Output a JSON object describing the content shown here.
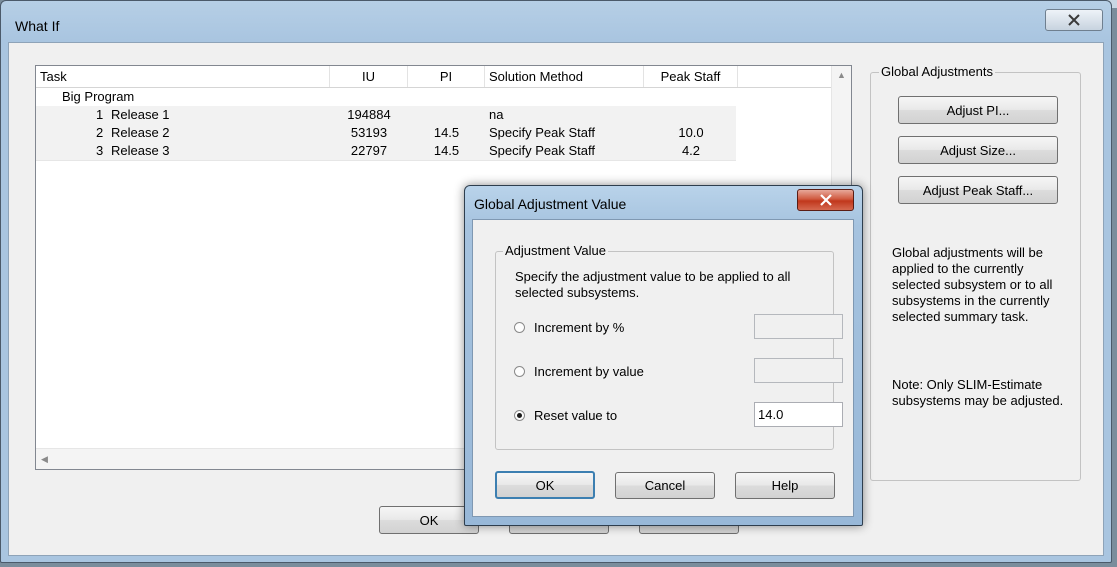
{
  "window": {
    "title": "What If"
  },
  "grid": {
    "headers": {
      "task": "Task",
      "iu": "IU",
      "pi": "PI",
      "method": "Solution Method",
      "peak": "Peak Staff"
    },
    "parent": {
      "label": "Big Program"
    },
    "rows": [
      {
        "num": "1",
        "name": "Release 1",
        "iu": "194884",
        "pi": "",
        "method": "na",
        "peak": ""
      },
      {
        "num": "2",
        "name": "Release 2",
        "iu": "53193",
        "pi": "14.5",
        "method": "Specify Peak Staff",
        "peak": "10.0"
      },
      {
        "num": "3",
        "name": "Release 3",
        "iu": "22797",
        "pi": "14.5",
        "method": "Specify Peak Staff",
        "peak": "4.2"
      }
    ]
  },
  "global_adjustments": {
    "legend": "Global Adjustments",
    "buttons": {
      "adjust_pi": "Adjust PI...",
      "adjust_size": "Adjust Size...",
      "adjust_peak": "Adjust Peak Staff..."
    },
    "info": "Global adjustments will be applied to the currently selected subsystem or to all subsystems in the currently selected summary task.",
    "note": "Note: Only SLIM-Estimate subsystems may be adjusted."
  },
  "footer": {
    "ok_label": "OK"
  },
  "dialog": {
    "title": "Global Adjustment Value",
    "group_legend": "Adjustment Value",
    "description": "Specify the adjustment value to be applied to all selected subsystems.",
    "options": {
      "increment_percent": {
        "label": "Increment by %",
        "checked": false,
        "value": ""
      },
      "increment_value": {
        "label": "Increment by value",
        "checked": false,
        "value": ""
      },
      "reset_value": {
        "label": "Reset value to",
        "checked": true,
        "value": "14.0"
      }
    },
    "buttons": {
      "ok": "OK",
      "cancel": "Cancel",
      "help": "Help"
    }
  },
  "icons": {
    "window_close": "close-icon",
    "dialog_close": "close-icon"
  }
}
